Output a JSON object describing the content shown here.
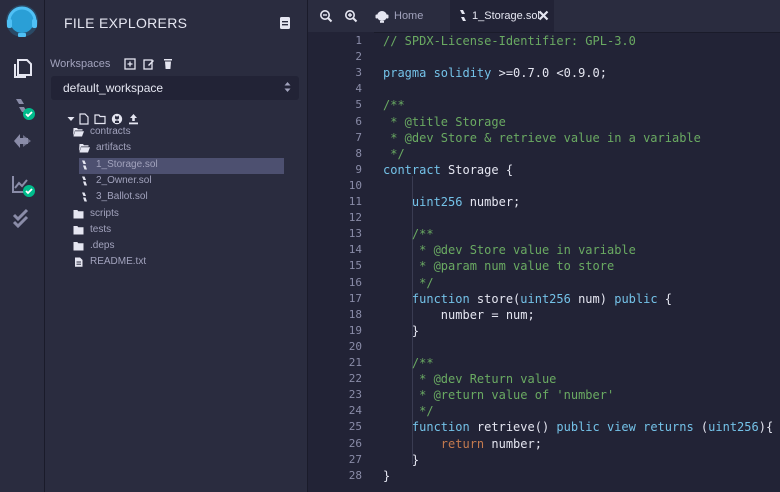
{
  "side_panel": {
    "title": "FILE EXPLORERS",
    "workspaces_label": "Workspaces",
    "workspace_selected": "default_workspace",
    "tree": [
      {
        "label": "contracts",
        "kind": "folder-open",
        "level": 0
      },
      {
        "label": "artifacts",
        "kind": "folder-open",
        "level": 1
      },
      {
        "label": "1_Storage.sol",
        "kind": "sol",
        "level": 1,
        "selected": true
      },
      {
        "label": "2_Owner.sol",
        "kind": "sol",
        "level": 1
      },
      {
        "label": "3_Ballot.sol",
        "kind": "sol",
        "level": 1
      },
      {
        "label": "scripts",
        "kind": "folder",
        "level": 0
      },
      {
        "label": "tests",
        "kind": "folder",
        "level": 0
      },
      {
        "label": ".deps",
        "kind": "folder",
        "level": 0
      },
      {
        "label": "README.txt",
        "kind": "file",
        "level": 0
      }
    ]
  },
  "tabs": [
    {
      "label": "Home"
    },
    {
      "label": "1_Storage.sol"
    }
  ],
  "code_lines": [
    {
      "n": "1",
      "tokens": [
        {
          "t": "// SPDX-License-Identifier: GPL-3.0",
          "c": "comment"
        }
      ]
    },
    {
      "n": "2",
      "tokens": []
    },
    {
      "n": "3",
      "tokens": [
        {
          "t": "pragma solidity",
          "c": "kw"
        },
        {
          "t": " >=0.7.0 <0.9.0;",
          "c": ""
        }
      ]
    },
    {
      "n": "4",
      "tokens": []
    },
    {
      "n": "5",
      "tokens": [
        {
          "t": "/**",
          "c": "comment"
        }
      ]
    },
    {
      "n": "6",
      "tokens": [
        {
          "t": " * @title Storage",
          "c": "comment"
        }
      ]
    },
    {
      "n": "7",
      "tokens": [
        {
          "t": " * @dev Store & retrieve value in a variable",
          "c": "comment"
        }
      ]
    },
    {
      "n": "8",
      "tokens": [
        {
          "t": " */",
          "c": "comment"
        }
      ]
    },
    {
      "n": "9",
      "tokens": [
        {
          "t": "contract",
          "c": "kw"
        },
        {
          "t": " Storage {",
          "c": ""
        }
      ]
    },
    {
      "n": "10",
      "tokens": []
    },
    {
      "n": "11",
      "tokens": [
        {
          "t": "    ",
          "c": ""
        },
        {
          "t": "uint256",
          "c": "kw"
        },
        {
          "t": " number;",
          "c": ""
        }
      ]
    },
    {
      "n": "12",
      "tokens": []
    },
    {
      "n": "13",
      "tokens": [
        {
          "t": "    /**",
          "c": "comment"
        }
      ]
    },
    {
      "n": "14",
      "tokens": [
        {
          "t": "     * @dev Store value in variable",
          "c": "comment"
        }
      ]
    },
    {
      "n": "15",
      "tokens": [
        {
          "t": "     * @param num value to store",
          "c": "comment"
        }
      ]
    },
    {
      "n": "16",
      "tokens": [
        {
          "t": "     */",
          "c": "comment"
        }
      ]
    },
    {
      "n": "17",
      "tokens": [
        {
          "t": "    ",
          "c": ""
        },
        {
          "t": "function",
          "c": "kw"
        },
        {
          "t": " store(",
          "c": ""
        },
        {
          "t": "uint256",
          "c": "kw"
        },
        {
          "t": " num) ",
          "c": ""
        },
        {
          "t": "public",
          "c": "kw"
        },
        {
          "t": " {",
          "c": ""
        }
      ]
    },
    {
      "n": "18",
      "tokens": [
        {
          "t": "        number = num;",
          "c": ""
        }
      ]
    },
    {
      "n": "19",
      "tokens": [
        {
          "t": "    }",
          "c": ""
        }
      ]
    },
    {
      "n": "20",
      "tokens": []
    },
    {
      "n": "21",
      "tokens": [
        {
          "t": "    /**",
          "c": "comment"
        }
      ]
    },
    {
      "n": "22",
      "tokens": [
        {
          "t": "     * @dev Return value",
          "c": "comment"
        }
      ]
    },
    {
      "n": "23",
      "tokens": [
        {
          "t": "     * @return value of 'number'",
          "c": "comment"
        }
      ]
    },
    {
      "n": "24",
      "tokens": [
        {
          "t": "     */",
          "c": "comment"
        }
      ]
    },
    {
      "n": "25",
      "tokens": [
        {
          "t": "    ",
          "c": ""
        },
        {
          "t": "function",
          "c": "kw"
        },
        {
          "t": " retrieve() ",
          "c": ""
        },
        {
          "t": "public view returns",
          "c": "kw"
        },
        {
          "t": " (",
          "c": ""
        },
        {
          "t": "uint256",
          "c": "kw"
        },
        {
          "t": "){",
          "c": ""
        }
      ]
    },
    {
      "n": "26",
      "tokens": [
        {
          "t": "        ",
          "c": ""
        },
        {
          "t": "return",
          "c": "ret"
        },
        {
          "t": " number;",
          "c": ""
        }
      ]
    },
    {
      "n": "27",
      "tokens": [
        {
          "t": "    }",
          "c": ""
        }
      ]
    },
    {
      "n": "28",
      "tokens": [
        {
          "t": "}",
          "c": ""
        }
      ]
    }
  ],
  "colors": {
    "background": "#222336",
    "panel": "#2a2c3f",
    "accent": "#2a9fd6",
    "success": "#00bc8c",
    "comment": "#6aaa62",
    "keyword": "#74c2e8",
    "return_keyword": "#c47a4e",
    "selected_row": "#4d5070"
  },
  "icons": {
    "logo": "remix-logo-icon",
    "iconbar": [
      "file-explorer-icon",
      "solidity-compiler-icon",
      "deploy-run-icon",
      "analysis-icon",
      "unit-testing-icon"
    ],
    "editor": [
      "zoom-in-icon",
      "zoom-out-icon",
      "home-icon",
      "solidity-file-icon",
      "close-icon"
    ]
  }
}
